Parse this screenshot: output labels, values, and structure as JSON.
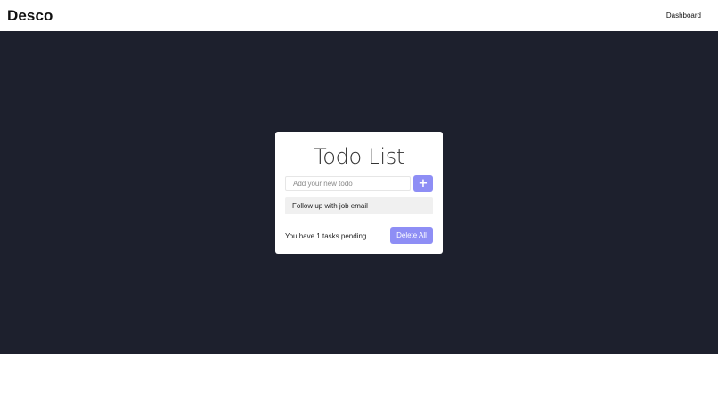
{
  "navbar": {
    "brand": "Desco",
    "link": "Dashboard"
  },
  "todo": {
    "title": "Todo List",
    "input_placeholder": "Add your new todo",
    "input_value": "",
    "add_label": "+",
    "items": [
      {
        "text": "Follow up with job email"
      }
    ],
    "pending_prefix": "You have ",
    "pending_count": "1",
    "pending_suffix": " tasks pending",
    "delete_all_label": "Delete All"
  },
  "colors": {
    "hero_background": "#1d202d",
    "accent": "#8e8ef5",
    "item_background": "#f0f0f0"
  },
  "icons": {
    "add": "plus-icon"
  }
}
